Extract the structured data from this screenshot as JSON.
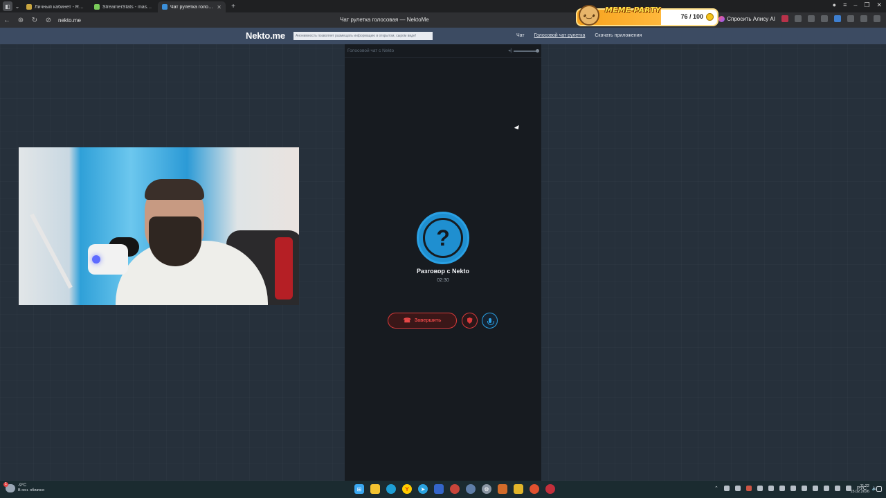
{
  "browser": {
    "tabs": [
      {
        "title": "Личный кабинет - Rampa",
        "favicon_color": "#c9a640",
        "active": false
      },
      {
        "title": "StreamerStats - masadaa",
        "favicon_color": "#7acb5a",
        "active": false
      },
      {
        "title": "Чат рулетка голосовая",
        "favicon_color": "#3b8fd9",
        "active": true
      }
    ],
    "url": "nekto.me",
    "page_title": "Чат рулетка голосовая — NektoMe",
    "ask_alice_label": "Спросить Алису AI",
    "meme_party": {
      "title": "MEME-PARTY",
      "score": "76 / 100"
    }
  },
  "site": {
    "logo": "Nekto.me",
    "anon_note": "Анонимность позволяет размещать информацию в открытом, сыром виде!",
    "nav": [
      {
        "label": "Чат",
        "active": false
      },
      {
        "label": "Голосовой чат рулетка",
        "active": true
      },
      {
        "label": "Скачать приложения",
        "active": false
      }
    ]
  },
  "chat": {
    "panel_title": "Голосовой чат с Nekto",
    "avatar_symbol": "?",
    "conversation_title": "Разговор с Nekto",
    "timer": "02:30",
    "end_button": "Завершить",
    "accent": "#2aa0e3",
    "danger": "#d83a3a"
  },
  "taskbar": {
    "weather_temp": "-9°C",
    "weather_desc": "В осн. облачно",
    "weather_badge": "1",
    "lang": "РУС",
    "time": "11:22",
    "date": "15.02.2026",
    "apps": [
      {
        "icon": "windows-start-icon",
        "color": "#3aa7f0"
      },
      {
        "icon": "file-explorer-icon",
        "color": "#f2c230"
      },
      {
        "icon": "edge-icon",
        "color": "#1e9fd6"
      },
      {
        "icon": "yandex-browser-icon",
        "color": "#ffcc00"
      },
      {
        "icon": "telegram-icon",
        "color": "#2aa3e0"
      },
      {
        "icon": "app-blue-icon",
        "color": "#3465c9"
      },
      {
        "icon": "app-red-icon",
        "color": "#c8453a"
      },
      {
        "icon": "app-light-icon",
        "color": "#5f7ea8"
      },
      {
        "icon": "settings-icon",
        "color": "#8a96a3"
      },
      {
        "icon": "app-orange-icon",
        "color": "#d26b2a"
      },
      {
        "icon": "app-yellow-icon",
        "color": "#e2b52a"
      },
      {
        "icon": "app-fire-icon",
        "color": "#e0512f"
      },
      {
        "icon": "app-rec-icon",
        "color": "#c32f3b"
      }
    ]
  }
}
